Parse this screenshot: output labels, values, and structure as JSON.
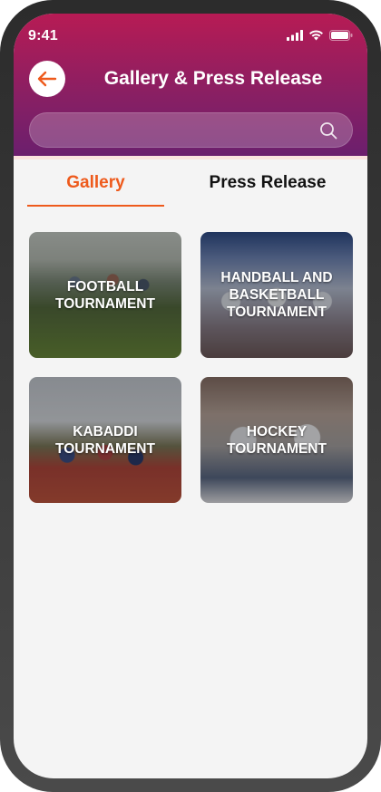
{
  "status_bar": {
    "time": "9:41"
  },
  "header": {
    "title": "Gallery & Press Release"
  },
  "search": {
    "placeholder": "",
    "value": ""
  },
  "tabs": [
    {
      "label": "Gallery",
      "active": true
    },
    {
      "label": "Press Release",
      "active": false
    }
  ],
  "gallery": {
    "items": [
      {
        "label": "FOOTBALL\nTOURNAMENT"
      },
      {
        "label": "HANDBALL AND\nBASKETBALL\nTOURNAMENT"
      },
      {
        "label": "KABADDI\nTOURNAMENT"
      },
      {
        "label": "HOCKEY\nTOURNAMENT"
      }
    ]
  },
  "colors": {
    "header_start": "#b71b54",
    "header_end": "#6a1f6e",
    "accent": "#ee5a1c"
  },
  "icons": {
    "back": "arrow-left-icon",
    "search": "search-icon",
    "signal": "signal-icon",
    "wifi": "wifi-icon",
    "battery": "battery-icon"
  }
}
